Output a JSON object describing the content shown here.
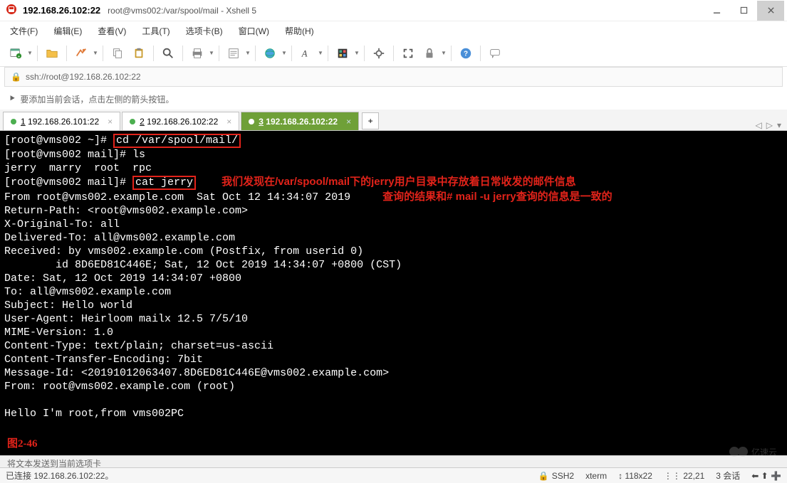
{
  "window": {
    "host_title": "192.168.26.102:22",
    "path_title": "root@vms002:/var/spool/mail - Xshell 5"
  },
  "menubar": [
    "文件(F)",
    "编辑(E)",
    "查看(V)",
    "工具(T)",
    "选项卡(B)",
    "窗口(W)",
    "帮助(H)"
  ],
  "address": "ssh://root@192.168.26.102:22",
  "hint": "要添加当前会话，点击左侧的箭头按钮。",
  "tabs": [
    {
      "label": "1 192.168.26.101:22",
      "accel": "1",
      "rest": " 192.168.26.101:22",
      "active": false
    },
    {
      "label": "2 192.168.26.102:22",
      "accel": "2",
      "rest": " 192.168.26.102:22",
      "active": false
    },
    {
      "label": "3 192.168.26.102:22",
      "accel": "3",
      "rest": " 192.168.26.102:22",
      "active": true
    }
  ],
  "toolbar_icons": [
    "new-session",
    "open",
    "reconnect",
    "copy",
    "paste",
    "search",
    "print",
    "properties",
    "web",
    "font",
    "color-scheme",
    "script",
    "fullscreen",
    "transparent",
    "lock",
    "help",
    "chat"
  ],
  "terminal": {
    "l1_prefix": "[root@vms002 ~]# ",
    "cmd1": "cd /var/spool/mail/",
    "l2": "[root@vms002 mail]# ls",
    "l3": "jerry  marry  root  rpc",
    "l4_prefix": "[root@vms002 mail]# ",
    "cmd2": "cat jerry",
    "note1": "我们发现在/var/spool/mail下的jerry用户目录中存放着日常收发的邮件信息",
    "l5": "From root@vms002.example.com  Sat Oct 12 14:34:07 2019",
    "note2": "查询的结果和# mail -u jerry查询的信息是一致的",
    "l6": "Return-Path: <root@vms002.example.com>",
    "l7": "X-Original-To: all",
    "l8": "Delivered-To: all@vms002.example.com",
    "l9": "Received: by vms002.example.com (Postfix, from userid 0)",
    "l10": "        id 8D6ED81C446E; Sat, 12 Oct 2019 14:34:07 +0800 (CST)",
    "l11": "Date: Sat, 12 Oct 2019 14:34:07 +0800",
    "l12": "To: all@vms002.example.com",
    "l13": "Subject: Hello world",
    "l14": "User-Agent: Heirloom mailx 12.5 7/5/10",
    "l15": "MIME-Version: 1.0",
    "l16": "Content-Type: text/plain; charset=us-ascii",
    "l17": "Content-Transfer-Encoding: 7bit",
    "l18": "Message-Id: <20191012063407.8D6ED81C446E@vms002.example.com>",
    "l19": "From: root@vms002.example.com (root)",
    "l20": "",
    "l21": "Hello I'm root,from vms002PC",
    "fig": "图2-46"
  },
  "dragbar": "将文本发送到当前选项卡",
  "status": {
    "conn": "已连接 192.168.26.102:22。",
    "proto_icon": "🔒",
    "proto": "SSH2",
    "term": "xterm",
    "size": "↕ 118x22",
    "cursor": "⋮⋮ 22,21",
    "sessions": "3 会话",
    "nav": "⬅ ⬆ ➕"
  }
}
